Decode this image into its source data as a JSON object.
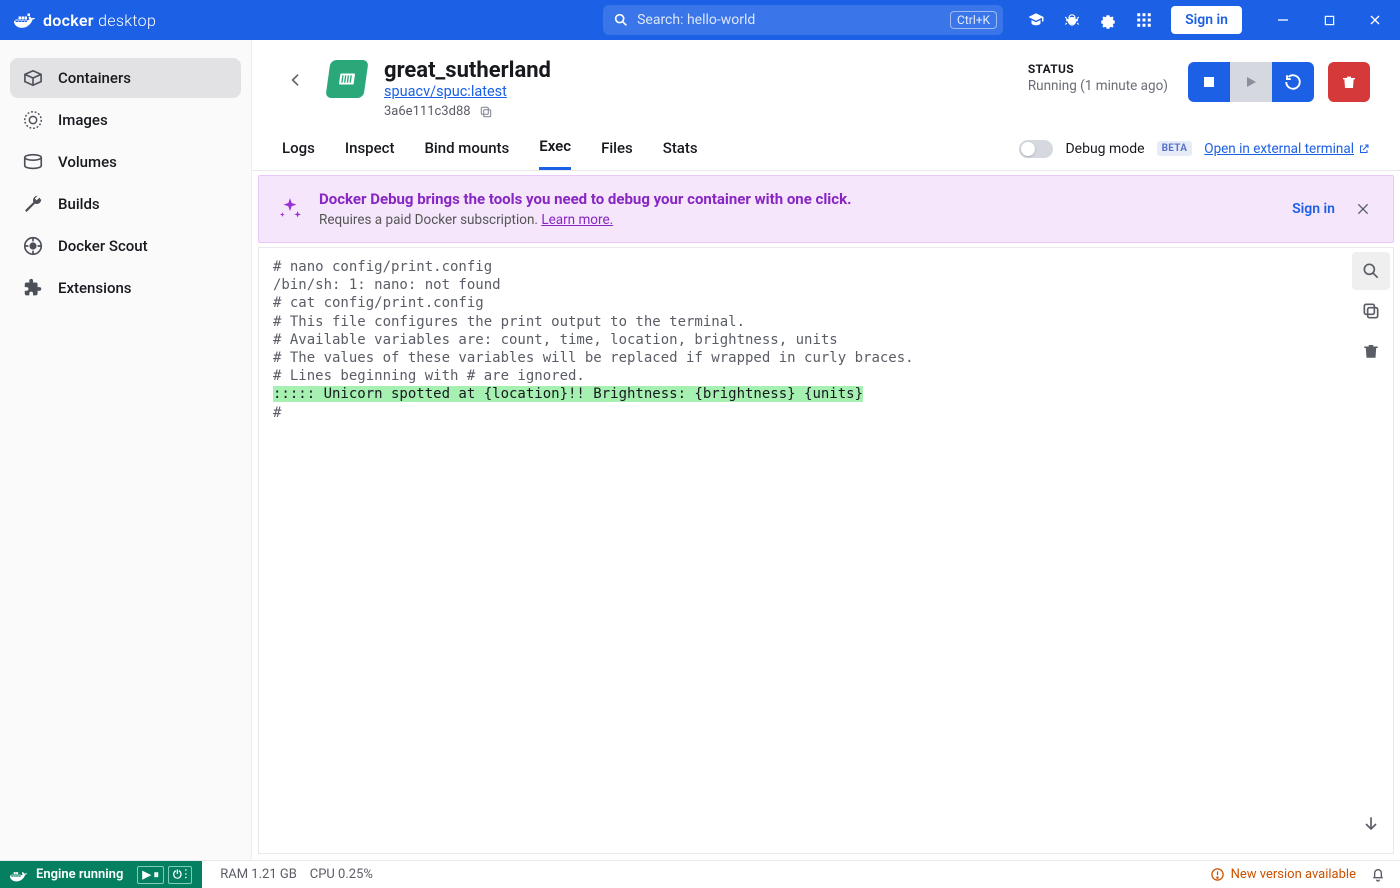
{
  "titlebar": {
    "logo_bold": "docker",
    "logo_light": "desktop",
    "search_placeholder": "Search: hello-world",
    "shortcut": "Ctrl+K",
    "signin": "Sign in"
  },
  "sidebar": {
    "items": [
      {
        "label": "Containers"
      },
      {
        "label": "Images"
      },
      {
        "label": "Volumes"
      },
      {
        "label": "Builds"
      },
      {
        "label": "Docker Scout"
      },
      {
        "label": "Extensions"
      }
    ]
  },
  "container": {
    "name": "great_sutherland",
    "image": "spuacv/spuc:latest",
    "hash": "3a6e111c3d88",
    "status_label": "STATUS",
    "status_value": "Running (1 minute ago)"
  },
  "tabs": {
    "items": [
      "Logs",
      "Inspect",
      "Bind mounts",
      "Exec",
      "Files",
      "Stats"
    ],
    "active": "Exec",
    "debug_label": "Debug mode",
    "beta": "BETA",
    "external": "Open in external terminal"
  },
  "banner": {
    "title": "Docker Debug brings the tools you need to debug your container with one click.",
    "sub_prefix": "Requires a paid Docker subscription. ",
    "sub_link": "Learn more.",
    "signin": "Sign in"
  },
  "terminal": {
    "lines": [
      "# nano config/print.config",
      "/bin/sh: 1: nano: not found",
      "# cat config/print.config",
      "# This file configures the print output to the terminal.",
      "# Available variables are: count, time, location, brightness, units",
      "# The values of these variables will be replaced if wrapped in curly braces.",
      "# Lines beginning with # are ignored."
    ],
    "highlight": "::::: Unicorn spotted at {location}!! Brightness: {brightness} {units}",
    "prompt": "# "
  },
  "statusbar": {
    "engine": "Engine running",
    "ram": "RAM 1.21 GB",
    "cpu": "CPU 0.25%",
    "update": "New version available"
  }
}
